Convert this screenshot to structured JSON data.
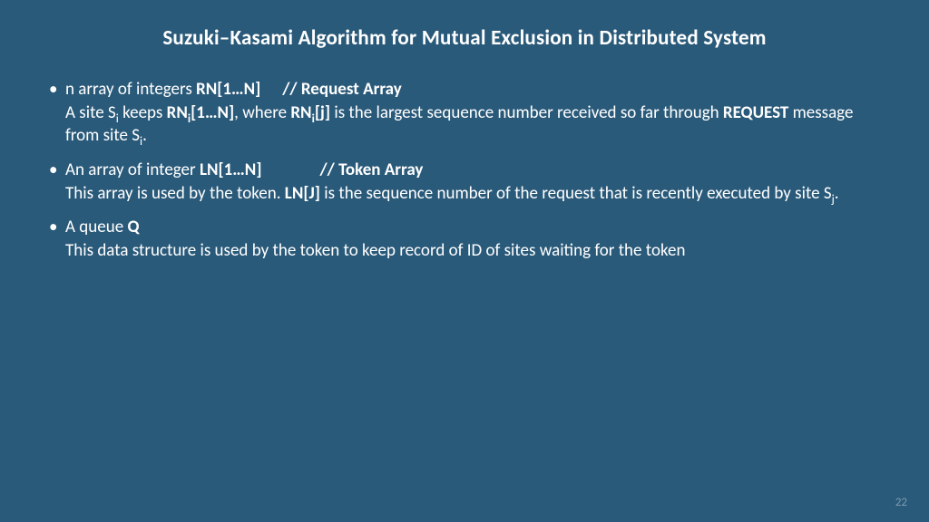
{
  "title": "Suzuki–Kasami Algorithm for Mutual Exclusion in Distributed System",
  "bullets": [
    {
      "line1_pre": "n array of integers ",
      "line1_bold1": "RN[1…N]",
      "line1_comment": "// Request Array",
      "line2_a": "A site S",
      "line2_sub1": "i",
      "line2_b": " keeps ",
      "line2_bold1a": "RN",
      "line2_bold1sub": "i",
      "line2_bold1b": "[1…N]",
      "line2_c": ", where ",
      "line2_bold2a": "RN",
      "line2_bold2sub": "i",
      "line2_bold2b": "[j]",
      "line2_d": " is the largest sequence number received so far through ",
      "line2_bold3": "REQUEST",
      "line2_e": " message from site S",
      "line2_sub2": "i",
      "line2_f": "."
    },
    {
      "line1_pre": "An array of integer ",
      "line1_bold1": "LN[1…N]",
      "line1_comment": "// Token Array",
      "line2_a": "This array is used by the token. ",
      "line2_bold1": "LN[J]",
      "line2_b": " is the sequence number of the request that is recently executed by site S",
      "line2_sub1": "j",
      "line2_c": "."
    },
    {
      "line1_pre": "A queue ",
      "line1_bold1": "Q",
      "line2_a": "This data structure is used by the token to keep record of ID of sites waiting for the token"
    }
  ],
  "page_number": "22"
}
